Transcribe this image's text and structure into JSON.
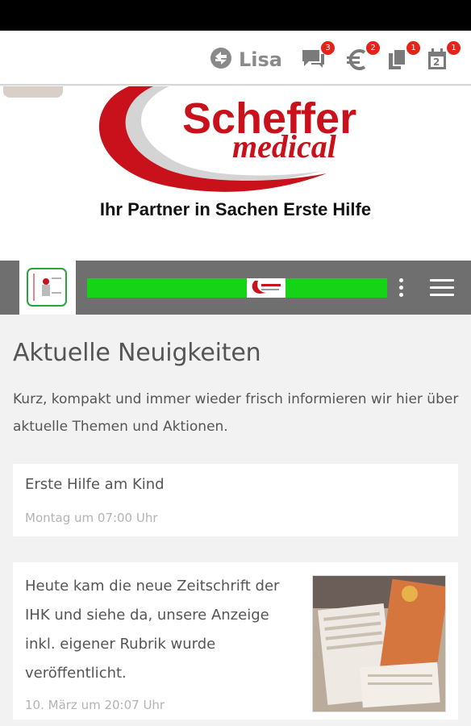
{
  "appbar": {
    "user_name": "Lisa",
    "badges": {
      "messages": "3",
      "payments": "2",
      "documents": "1",
      "calendar": "1"
    },
    "calendar_day": "2"
  },
  "banner": {
    "logo_word1": "Scheffer",
    "logo_word2": "medical",
    "tagline": "Ihr Partner in Sachen Erste Hilfe"
  },
  "colors": {
    "brand_red": "#c8111b",
    "marquee_green": "#17d317",
    "nav_gray": "#6f6f6f",
    "badge_red": "#e2241b"
  },
  "main": {
    "title": "Aktuelle Neuigkeiten",
    "intro": "Kurz, kompakt und immer wieder frisch informieren wir hier über aktuelle Themen und Aktionen.",
    "posts": [
      {
        "headline": "Erste Hilfe am Kind",
        "date": "Montag um 07:00 Uhr"
      },
      {
        "headline": "Heute kam die neue Zeitschrift der IHK und siehe da, unsere Anzeige inkl. eigener Rubrik wurde veröffentlicht.",
        "date": "10. März um 20:07 Uhr"
      }
    ]
  }
}
